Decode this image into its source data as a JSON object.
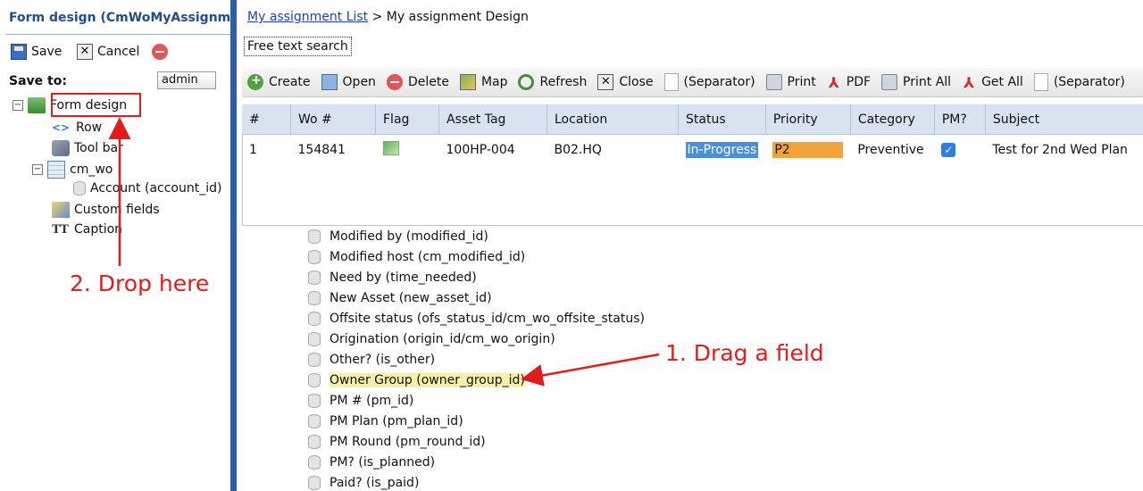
{
  "left_panel": {
    "title": "Form design (CmWoMyAssignme",
    "save_label": "Save",
    "cancel_label": "Cancel",
    "save_to_label": "Save to:",
    "save_to_value": "admin",
    "tree": {
      "root_label": "Form design",
      "row_label": "Row",
      "toolbar_label": "Tool bar",
      "table_label": "cm_wo",
      "account_label": "Account (account_id)",
      "custom_fields_label": "Custom fields",
      "caption_label": "Caption"
    }
  },
  "annotations": {
    "drop_here": "2. Drop here",
    "drag_field": "1. Drag a field",
    "color": "#e41b1b"
  },
  "main": {
    "breadcrumb_link": "My assignment List",
    "breadcrumb_rest": " > My assignment Design",
    "free_text_search": "Free text search",
    "toolbar": {
      "create": "Create",
      "open": "Open",
      "delete": "Delete",
      "map": "Map",
      "refresh": "Refresh",
      "close": "Close",
      "separator1": "(Separator)",
      "print": "Print",
      "pdf": "PDF",
      "print_all": "Print All",
      "get_all": "Get All",
      "separator2": "(Separator)"
    },
    "grid": {
      "headers": [
        "#",
        "Wo #",
        "Flag",
        "Asset Tag",
        "Location",
        "Status",
        "Priority",
        "Category",
        "PM?",
        "Subject"
      ],
      "row": {
        "num": "1",
        "wo": "154841",
        "asset_tag": "100HP-004",
        "location": "B02.HQ",
        "status": "In-Progress",
        "priority": "P2",
        "category": "Preventive",
        "pm_checked": true,
        "subject": "Test for 2nd Wed Plan"
      }
    },
    "fields": [
      "Modified by (modified_id)",
      "Modified host (cm_modified_id)",
      "Need by (time_needed)",
      "New Asset (new_asset_id)",
      "Offsite status (ofs_status_id/cm_wo_offsite_status)",
      "Origination (origin_id/cm_wo_origin)",
      "Other? (is_other)",
      "Owner Group (owner_group_id)",
      "PM # (pm_id)",
      "PM Plan (pm_plan_id)",
      "PM Round (pm_round_id)",
      "PM? (is_planned)",
      "Paid? (is_paid)"
    ]
  }
}
